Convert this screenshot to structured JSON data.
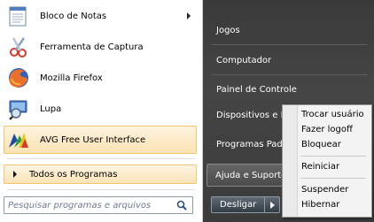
{
  "programs": [
    {
      "label": "Bloco de Notas",
      "icon": "notepad-icon",
      "has_submenu": true
    },
    {
      "label": "Ferramenta de Captura",
      "icon": "snipping-tool-icon"
    },
    {
      "label": "Mozilla Firefox",
      "icon": "firefox-icon"
    },
    {
      "label": "Lupa",
      "icon": "magnifier-icon"
    },
    {
      "label": "AVG Free User Interface",
      "icon": "avg-icon"
    }
  ],
  "all_programs_label": "Todos os Programas",
  "search": {
    "placeholder": "Pesquisar programas e arquivos"
  },
  "right_items": [
    {
      "label": "Jogos"
    },
    {
      "label": "Computador"
    },
    {
      "label": "Painel de Controle"
    },
    {
      "label": "Dispositivos e Ir"
    },
    {
      "label": "Programas Padr"
    },
    {
      "label": "Ajuda e Suporte"
    }
  ],
  "shutdown": {
    "label": "Desligar"
  },
  "power_menu": [
    {
      "label": "Trocar usuário"
    },
    {
      "label": "Fazer logoff"
    },
    {
      "label": "Bloquear"
    },
    {
      "label": "Reiniciar"
    },
    {
      "label": "Suspender"
    },
    {
      "label": "Hibernar"
    }
  ],
  "colors": {
    "highlight": "#fbe3b3",
    "dark_panel": "#3f3f3f"
  }
}
